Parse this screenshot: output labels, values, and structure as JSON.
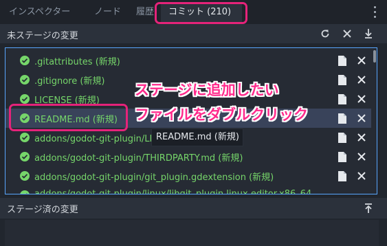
{
  "tabs": [
    {
      "label": "インスペクター"
    },
    {
      "label": "ノード"
    },
    {
      "label": "履歴"
    },
    {
      "label": "コミット (210)"
    }
  ],
  "unstaged": {
    "title": "未ステージの変更",
    "files": [
      {
        "name": ".gitattributes (新規)"
      },
      {
        "name": ".gitignore (新規)"
      },
      {
        "name": "LICENSE (新規)"
      },
      {
        "name": "README.md (新規)"
      },
      {
        "name": "addons/godot-git-plugin/LICENSE (新規)"
      },
      {
        "name": "addons/godot-git-plugin/THIRDPARTY.md (新規)"
      },
      {
        "name": "addons/godot-git-plugin/git_plugin.gdextension (新規)"
      },
      {
        "name": "addons/godot-git-plugin/linux/libgit_plugin.linux.editor.x86_64"
      }
    ]
  },
  "tooltip": "README.md (新規)",
  "staged": {
    "title": "ステージ済の変更"
  },
  "annotation": {
    "line1": "ステージに追加したい",
    "line2": "ファイルをダブルクリック"
  },
  "colors": {
    "accent": "#58a6ff",
    "file_green": "#76d66a",
    "highlight": "#e5237a"
  }
}
